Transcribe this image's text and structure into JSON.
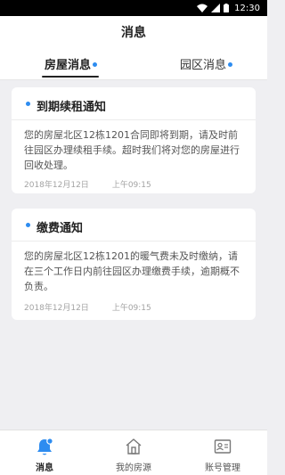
{
  "status_bar": {
    "time": "12:30",
    "icons": [
      "wifi-icon",
      "signal-icon",
      "battery-icon"
    ]
  },
  "header": {
    "title": "消息"
  },
  "tabs": [
    {
      "label": "房屋消息",
      "active": true,
      "has_dot": true
    },
    {
      "label": "园区消息",
      "active": false,
      "has_dot": true
    }
  ],
  "messages": [
    {
      "title": "到期续租通知",
      "body": "您的房屋北区12栋1201合同即将到期，请及时前往园区办理续租手续。超时我们将对您的房屋进行回收处理。",
      "date": "2018年12月12日",
      "time": "上午09:15"
    },
    {
      "title": "缴费通知",
      "body": "您的房屋北区12栋1201的暖气费未及时缴纳，请在三个工作日内前往园区办理缴费手续，逾期概不负责。",
      "date": "2018年12月12日",
      "time": "上午09:15"
    }
  ],
  "bottom_nav": [
    {
      "label": "消息",
      "icon": "bell-icon",
      "active": true
    },
    {
      "label": "我的房源",
      "icon": "home-icon",
      "active": false
    },
    {
      "label": "账号管理",
      "icon": "id-card-icon",
      "active": false
    }
  ],
  "colors": {
    "accent": "#2d8cf0",
    "background": "#efeff2",
    "status_bar": "#000000"
  }
}
